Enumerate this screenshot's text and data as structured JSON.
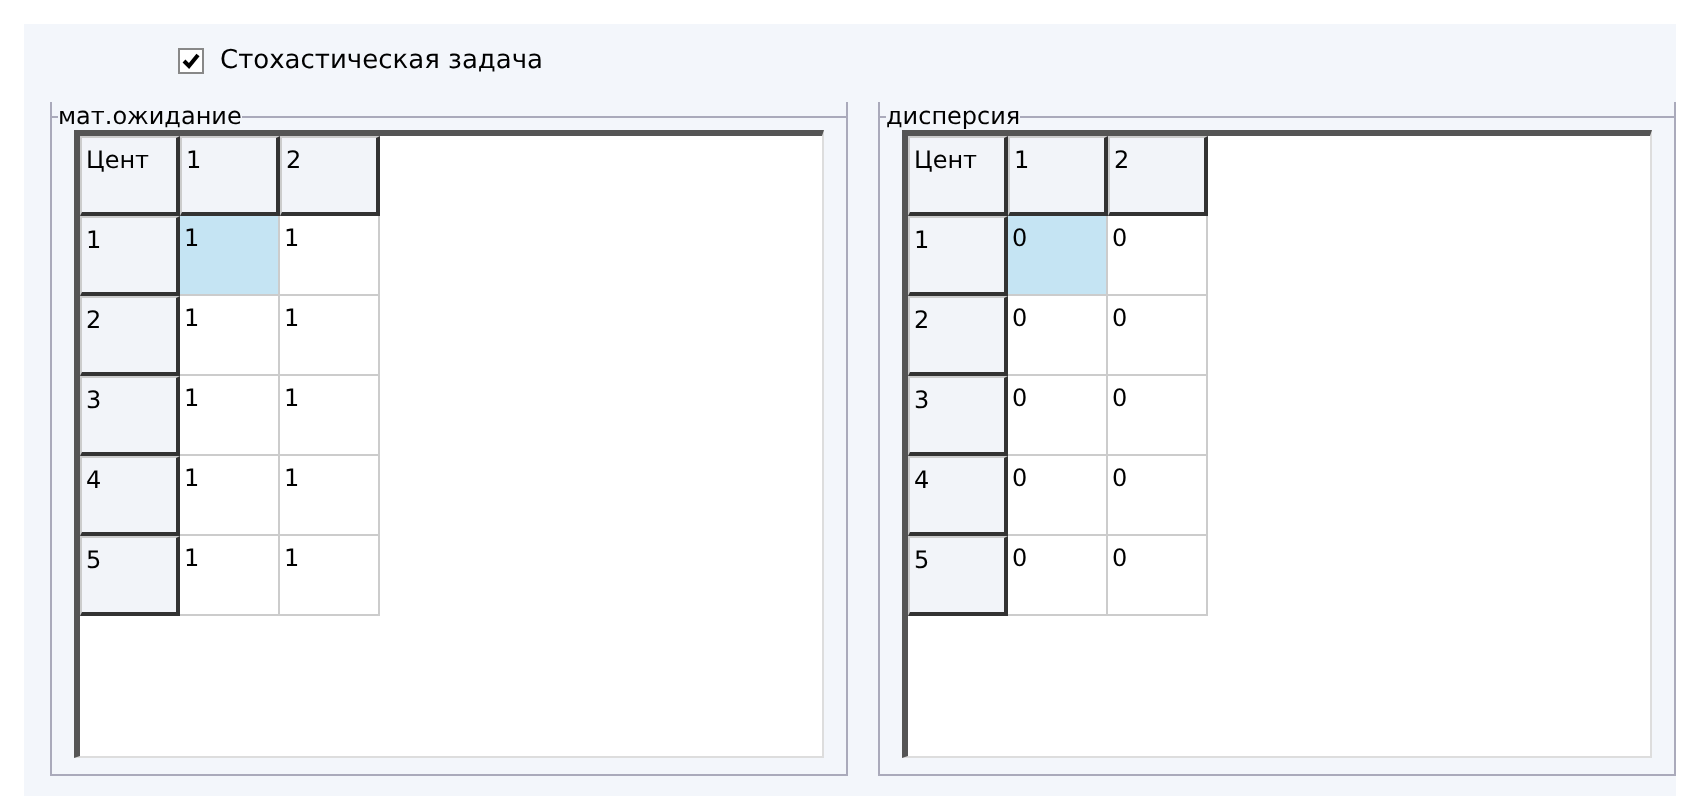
{
  "checkbox": {
    "label": "Стохастическая задача",
    "checked": true
  },
  "grids": [
    {
      "title": "мат.ожидание",
      "corner": "Цент",
      "columns": [
        "1",
        "2"
      ],
      "rows": [
        {
          "header": "1",
          "cells": [
            {
              "value": "1",
              "selected": true
            },
            {
              "value": "1",
              "selected": false
            }
          ]
        },
        {
          "header": "2",
          "cells": [
            {
              "value": "1",
              "selected": false
            },
            {
              "value": "1",
              "selected": false
            }
          ]
        },
        {
          "header": "3",
          "cells": [
            {
              "value": "1",
              "selected": false
            },
            {
              "value": "1",
              "selected": false
            }
          ]
        },
        {
          "header": "4",
          "cells": [
            {
              "value": "1",
              "selected": false
            },
            {
              "value": "1",
              "selected": false
            }
          ]
        },
        {
          "header": "5",
          "cells": [
            {
              "value": "1",
              "selected": false
            },
            {
              "value": "1",
              "selected": false
            }
          ]
        }
      ]
    },
    {
      "title": "дисперсия",
      "corner": "Цент",
      "columns": [
        "1",
        "2"
      ],
      "rows": [
        {
          "header": "1",
          "cells": [
            {
              "value": "0",
              "selected": true
            },
            {
              "value": "0",
              "selected": false
            }
          ]
        },
        {
          "header": "2",
          "cells": [
            {
              "value": "0",
              "selected": false
            },
            {
              "value": "0",
              "selected": false
            }
          ]
        },
        {
          "header": "3",
          "cells": [
            {
              "value": "0",
              "selected": false
            },
            {
              "value": "0",
              "selected": false
            }
          ]
        },
        {
          "header": "4",
          "cells": [
            {
              "value": "0",
              "selected": false
            },
            {
              "value": "0",
              "selected": false
            }
          ]
        },
        {
          "header": "5",
          "cells": [
            {
              "value": "0",
              "selected": false
            },
            {
              "value": "0",
              "selected": false
            }
          ]
        }
      ]
    }
  ]
}
